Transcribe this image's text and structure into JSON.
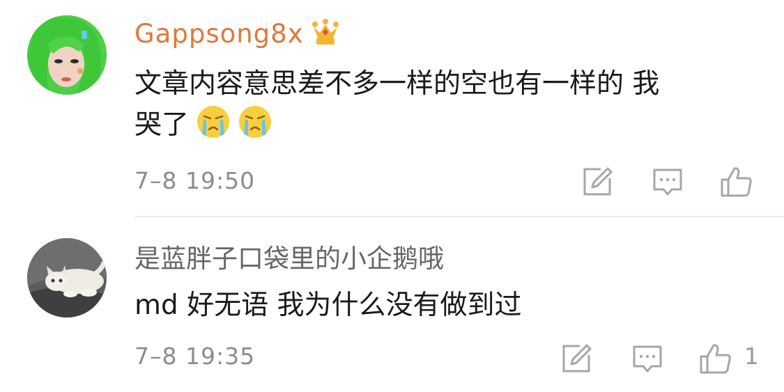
{
  "comments": [
    {
      "username": "Gappsong8x",
      "badge_icon": "crown-badge-icon",
      "text_line1": "文章内容意思差不多一样的空也有一样的  我",
      "text_line2": "哭了",
      "emojis": [
        "crying-face-icon",
        "crying-face-icon"
      ],
      "timestamp": "7–8 19:50",
      "actions": [
        "repost-icon",
        "reply-icon",
        "like-icon"
      ],
      "like_count": ""
    },
    {
      "username": "是蓝胖子口袋里的小企鹅哦",
      "text_line1": "md 好无语 我为什么没有做到过",
      "timestamp": "7–8 19:35",
      "actions": [
        "repost-icon",
        "reply-icon",
        "like-icon"
      ],
      "like_count": "1"
    }
  ],
  "colors": {
    "username_vip": "#e0783a",
    "username_normal": "#666666",
    "text": "#1a1a1a",
    "meta": "#8c8c8c",
    "icon": "#a6a6a6",
    "divider": "#ececec"
  }
}
